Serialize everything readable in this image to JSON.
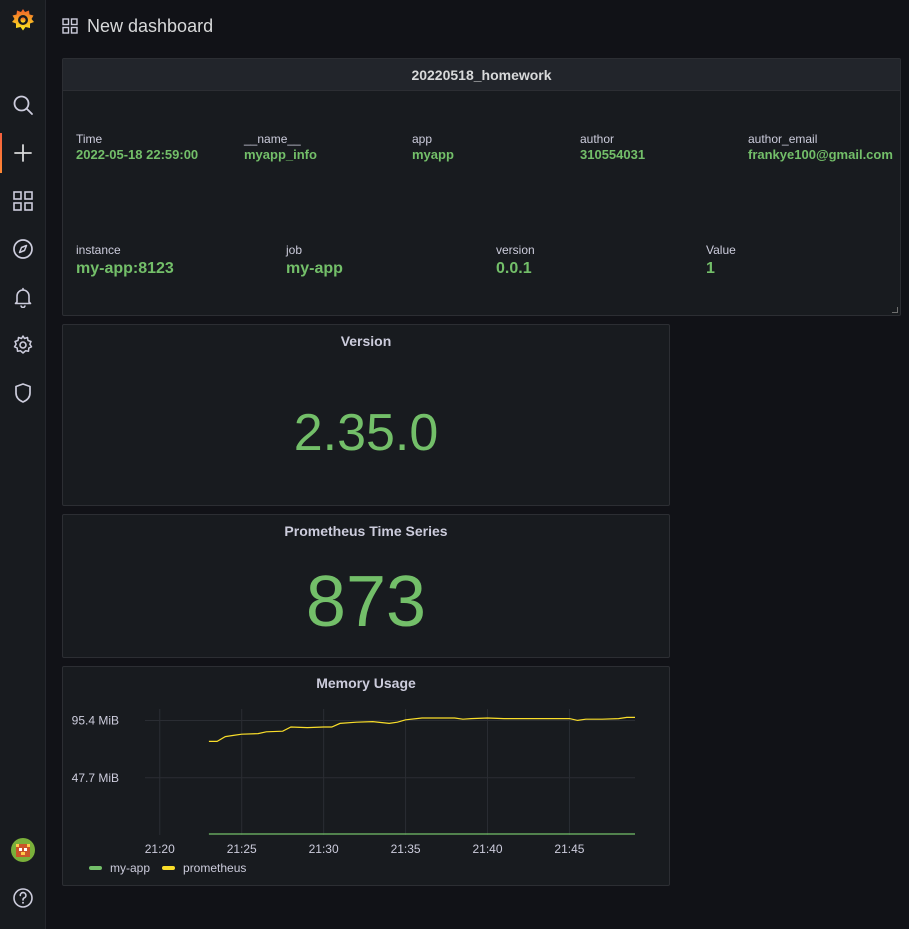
{
  "header": {
    "title": "New dashboard",
    "grid_icon": "dashboard-grid-icon"
  },
  "sidebar": {
    "items": [
      {
        "name": "grafana-logo",
        "icon": "grafana-logo"
      },
      {
        "name": "search",
        "icon": "search-icon"
      },
      {
        "name": "create",
        "icon": "plus-icon"
      },
      {
        "name": "dashboards",
        "icon": "grid-icon"
      },
      {
        "name": "explore",
        "icon": "compass-icon"
      },
      {
        "name": "alerting",
        "icon": "bell-icon"
      },
      {
        "name": "configuration",
        "icon": "gear-icon"
      },
      {
        "name": "server-admin",
        "icon": "shield-icon"
      },
      {
        "name": "profile",
        "icon": "avatar"
      },
      {
        "name": "help",
        "icon": "question-icon"
      }
    ]
  },
  "info_panel": {
    "title": "20220518_homework",
    "row1": [
      {
        "key": "Time",
        "value": "2022-05-18 22:59:00"
      },
      {
        "key": "__name__",
        "value": "myapp_info"
      },
      {
        "key": "app",
        "value": "myapp"
      },
      {
        "key": "author",
        "value": "310554031"
      },
      {
        "key": "author_email",
        "value": "frankye100@gmail.com"
      }
    ],
    "row2": [
      {
        "key": "instance",
        "value": "my-app:8123"
      },
      {
        "key": "job",
        "value": "my-app"
      },
      {
        "key": "version",
        "value": "0.0.1"
      },
      {
        "key": "Value",
        "value": "1"
      }
    ]
  },
  "version_panel": {
    "title": "Version",
    "value": "2.35.0"
  },
  "series_panel": {
    "title": "Prometheus Time Series",
    "value": "873"
  },
  "memory_panel": {
    "title": "Memory Usage",
    "legend": [
      {
        "name": "my-app",
        "color": "#73bf69"
      },
      {
        "name": "prometheus",
        "color": "#fade2a"
      }
    ]
  },
  "colors": {
    "accent_green": "#73bf69",
    "accent_yellow": "#fade2a",
    "brand_orange": "#f57c2c"
  },
  "chart_data": {
    "type": "line",
    "title": "Memory Usage",
    "x_ticks": [
      "21:20",
      "21:25",
      "21:30",
      "21:35",
      "21:40",
      "21:45"
    ],
    "y_ticks": [
      "95.4 MiB",
      "47.7 MiB"
    ],
    "ylim_mib": [
      0,
      105
    ],
    "xlim_minutes": [
      "21:18",
      "21:49"
    ],
    "grid": true,
    "legend_position": "bottom-left",
    "series": [
      {
        "name": "my-app",
        "x": [
          "21:23",
          "21:49"
        ],
        "y_mib": [
          0.8,
          0.8
        ]
      },
      {
        "name": "prometheus",
        "x": [
          "21:23",
          "21:23.5",
          "21:24",
          "21:24.5",
          "21:25",
          "21:26",
          "21:26.5",
          "21:27.5",
          "21:28",
          "21:29",
          "21:30",
          "21:30.5",
          "21:31",
          "21:32",
          "21:33",
          "21:34",
          "21:34.5",
          "21:35",
          "21:36",
          "21:37",
          "21:38",
          "21:38.5",
          "21:39",
          "21:40",
          "21:41",
          "21:42",
          "21:43",
          "21:44",
          "21:45",
          "21:45.5",
          "21:46",
          "21:47",
          "21:48",
          "21:48.5",
          "21:49"
        ],
        "y_mib": [
          78,
          78,
          82,
          83,
          84,
          84.5,
          86,
          86.5,
          90,
          89.5,
          90,
          90,
          93,
          94,
          94.5,
          93,
          94,
          96,
          97.5,
          97.5,
          97.5,
          96.5,
          97,
          97.5,
          97,
          97,
          97,
          97,
          97,
          95.5,
          96.5,
          96.5,
          97,
          98,
          98
        ]
      }
    ]
  }
}
